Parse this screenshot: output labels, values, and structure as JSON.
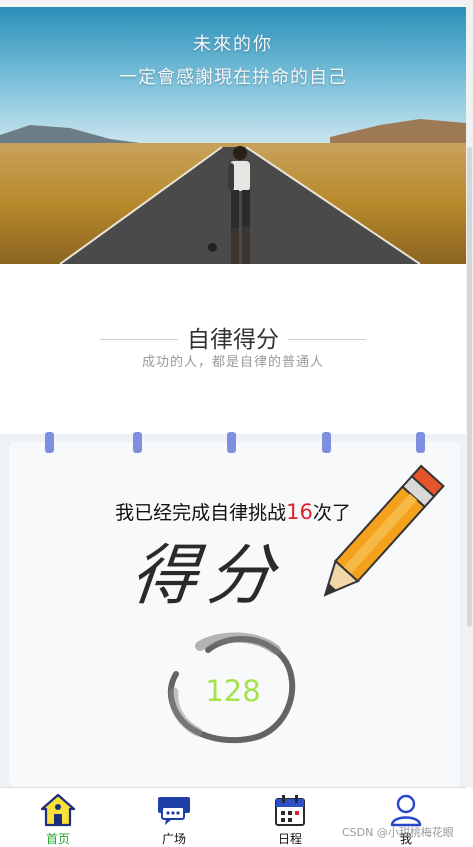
{
  "banner": {
    "line1": "未來的你",
    "line2": "一定會感謝現在拚命的自己"
  },
  "section": {
    "title": "自律得分",
    "subtitle": "成功的人，都是自律的普通人"
  },
  "score_card": {
    "challenge_prefix": "我已经完成自律挑战",
    "challenge_count": "16",
    "challenge_suffix": "次了",
    "headline": "得分",
    "score": "128"
  },
  "tabbar": {
    "items": [
      {
        "label": "首页",
        "icon": "home-icon",
        "active": true
      },
      {
        "label": "广场",
        "icon": "chat-bubbles-icon",
        "active": false
      },
      {
        "label": "日程",
        "icon": "calendar-icon",
        "active": false
      },
      {
        "label": "我",
        "icon": "user-icon",
        "active": false
      }
    ],
    "active_color": "#21a52f"
  },
  "watermark": "CSDN @小甜桃梅花眼"
}
